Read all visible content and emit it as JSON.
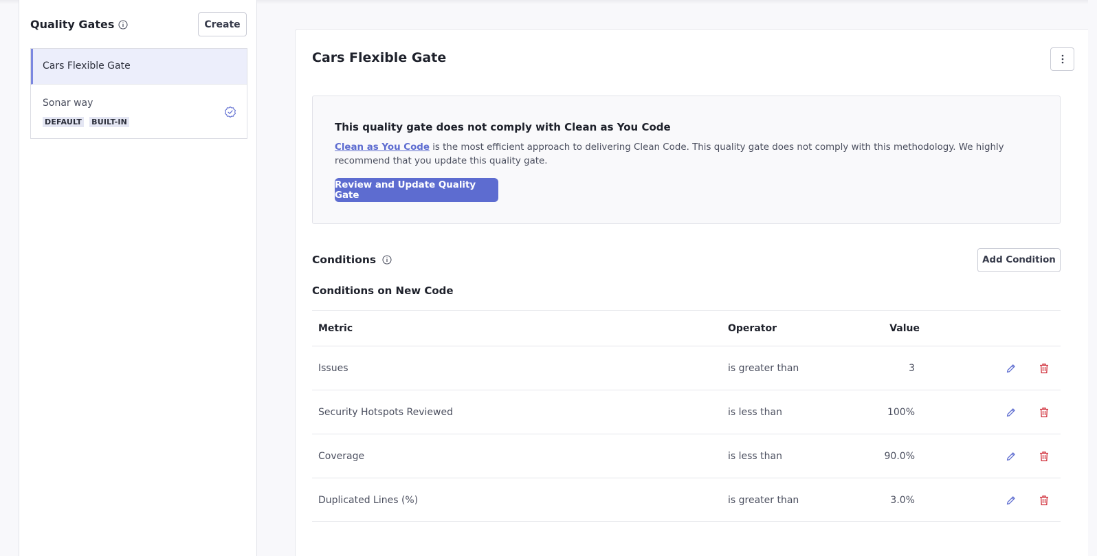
{
  "sidebar": {
    "title": "Quality Gates",
    "create_label": "Create",
    "gates": [
      {
        "name": "Cars Flexible Gate",
        "active": true
      },
      {
        "name": "Sonar way",
        "tags": [
          "DEFAULT",
          "BUILT-IN"
        ],
        "icon": "check-badge-icon"
      }
    ]
  },
  "main": {
    "gate_title": "Cars Flexible Gate",
    "banner": {
      "title": "This quality gate does not comply with Clean as You Code",
      "link_text": "Clean as You Code",
      "text": " is the most efficient approach to delivering Clean Code. This quality gate does not comply with this methodology. We highly recommend that you update this quality gate.",
      "button_label": "Review and Update Quality Gate"
    },
    "conditions": {
      "title": "Conditions",
      "add_label": "Add Condition",
      "subtitle": "Conditions on New Code",
      "columns": {
        "metric": "Metric",
        "operator": "Operator",
        "value": "Value"
      },
      "rows": [
        {
          "metric": "Issues",
          "operator": "is greater than",
          "value": "3"
        },
        {
          "metric": "Security Hotspots Reviewed",
          "operator": "is less than",
          "value": "100%"
        },
        {
          "metric": "Coverage",
          "operator": "is less than",
          "value": "90.0%"
        },
        {
          "metric": "Duplicated Lines (%)",
          "operator": "is greater than",
          "value": "3.0%"
        }
      ]
    }
  },
  "colors": {
    "accent": "#5d6cd0",
    "danger": "#d02f3a",
    "active_bg": "#eceefb"
  }
}
